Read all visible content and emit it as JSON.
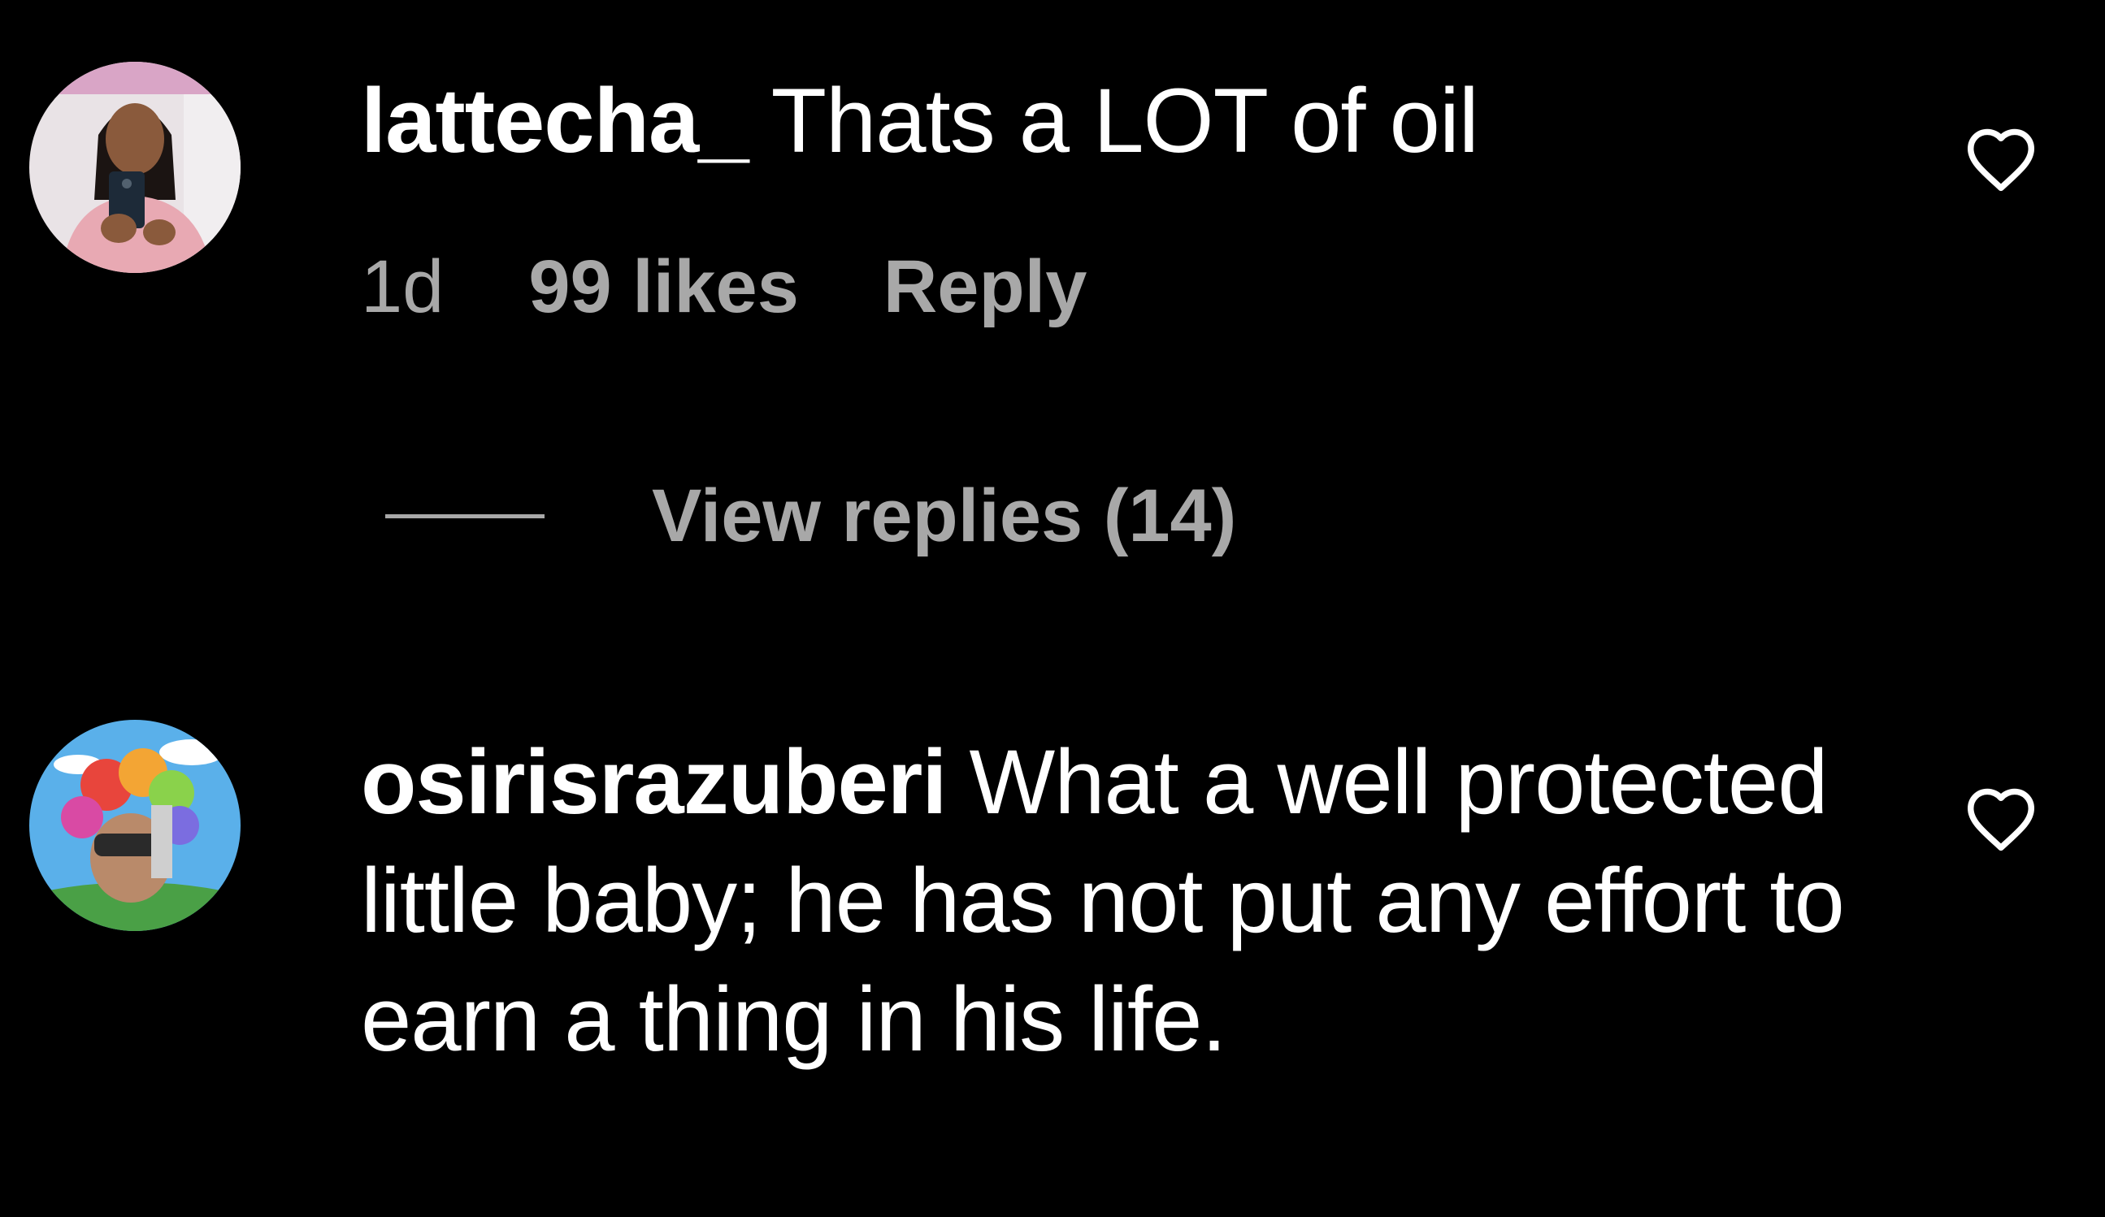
{
  "comments": [
    {
      "username": "lattecha_",
      "text": "Thats a LOT of oil",
      "time": "1d",
      "likes": "99 likes",
      "reply_label": "Reply",
      "view_replies": "View replies (14)",
      "avatar_icon": "profile-photo-selfie"
    },
    {
      "username": "osirisrazuberi",
      "text": "What a well protected little baby; he has not put any effort to earn a thing in his life.",
      "avatar_icon": "profile-photo-rainbow"
    }
  ],
  "icons": {
    "like": "heart-outline-icon"
  },
  "colors": {
    "background": "#000000",
    "primary_text": "#ffffff",
    "secondary_text": "#a8a8a8"
  }
}
